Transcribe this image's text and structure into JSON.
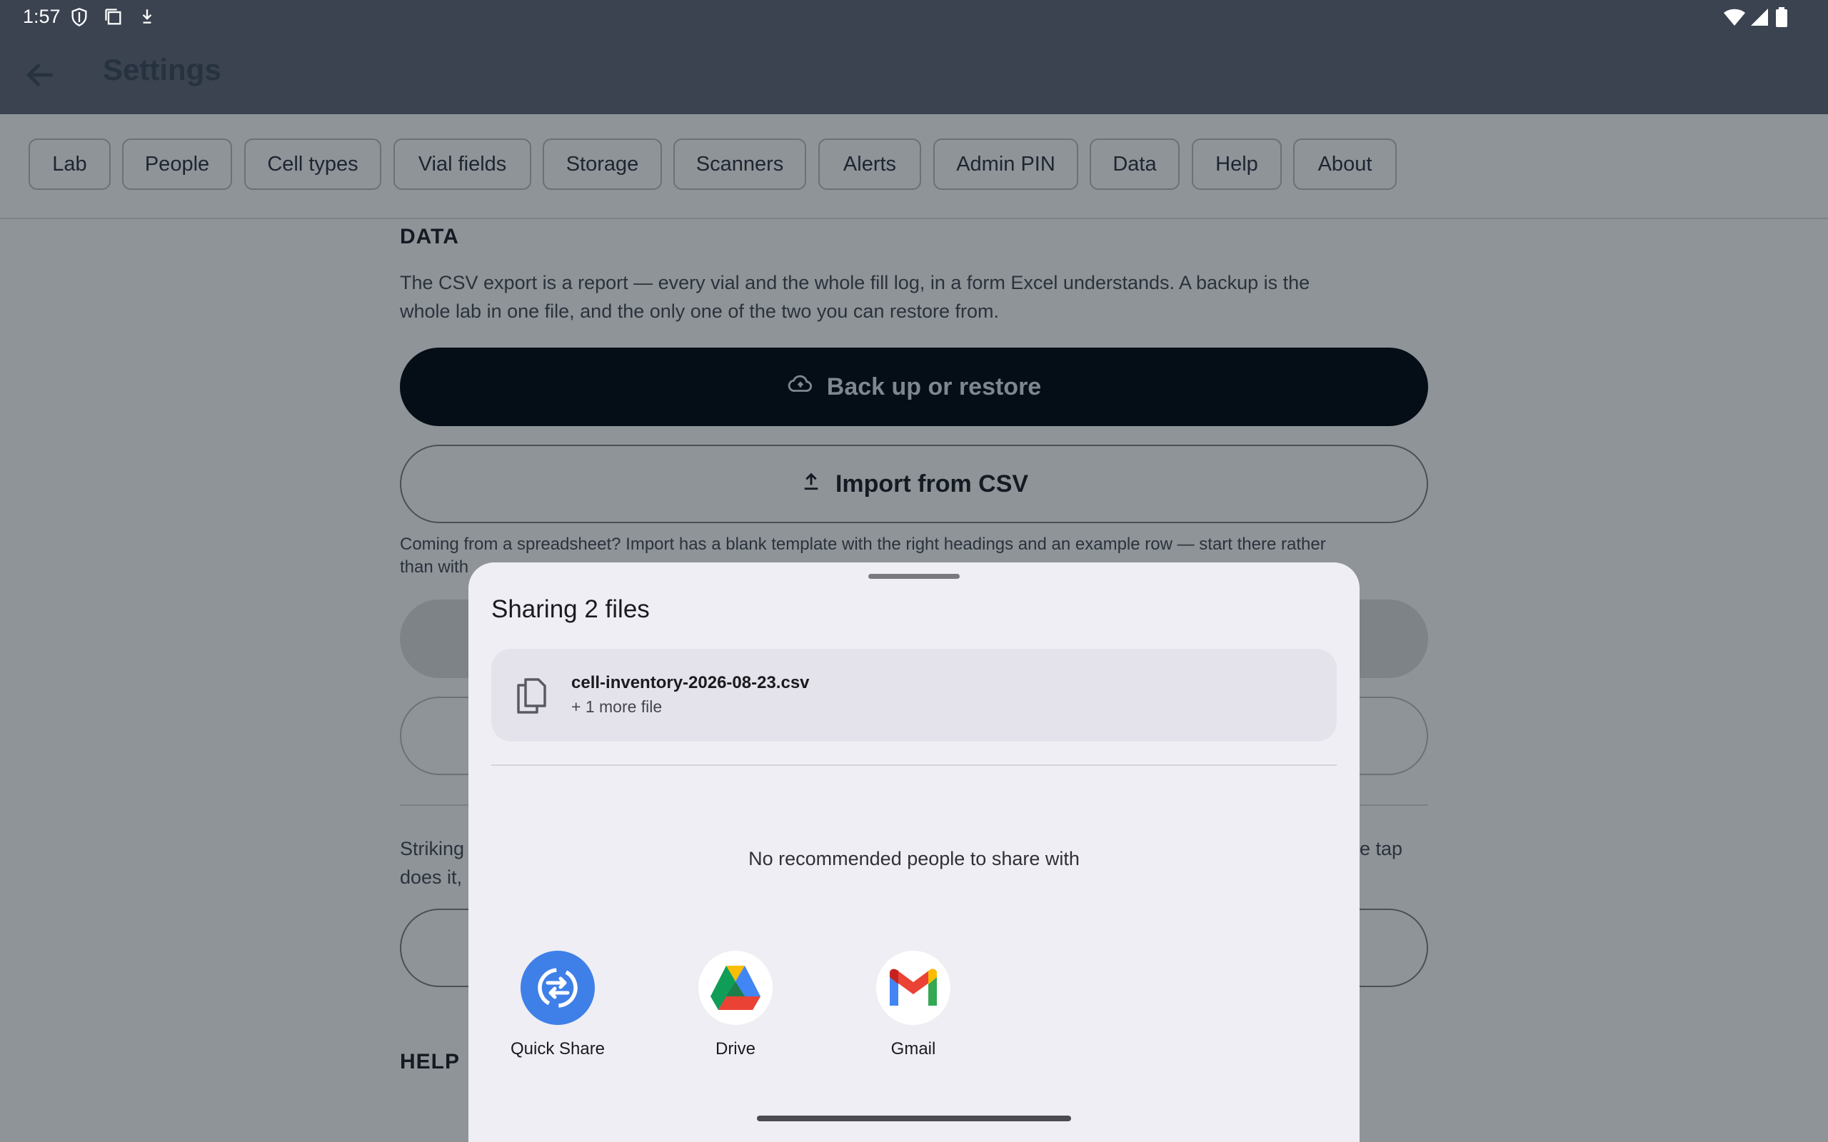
{
  "status_bar": {
    "time": "1:57"
  },
  "app_bar": {
    "title": "Settings"
  },
  "tabs": [
    {
      "label": "Lab"
    },
    {
      "label": "People"
    },
    {
      "label": "Cell types"
    },
    {
      "label": "Vial fields"
    },
    {
      "label": "Storage"
    },
    {
      "label": "Scanners"
    },
    {
      "label": "Alerts"
    },
    {
      "label": "Admin PIN"
    },
    {
      "label": "Data"
    },
    {
      "label": "Help"
    },
    {
      "label": "About"
    }
  ],
  "data_section": {
    "title": "DATA",
    "description_line1": "The CSV export is a report — every vial and the whole fill log, in a form Excel understands. A backup is the",
    "description_line2": "whole lab in one file, and the only one of the two you can restore from.",
    "backup_button": "Back up or restore",
    "import_button": "Import from CSV",
    "import_hint_line1": "Coming from a spreadsheet? Import has a blank template with the right headings and an example row — start there rather",
    "import_hint_line2": "than with",
    "striking_left_1": "Striking",
    "striking_left_2": "does it,",
    "striking_right": "e tap"
  },
  "help_section": {
    "title": "HELP"
  },
  "share_sheet": {
    "title": "Sharing 2 files",
    "file_name": "cell-inventory-2026-08-23.csv",
    "file_more": "+ 1 more file",
    "no_people": "No recommended people to share with",
    "apps": [
      {
        "label": "Quick Share",
        "icon": "quick-share-icon"
      },
      {
        "label": "Drive",
        "icon": "google-drive-icon"
      },
      {
        "label": "Gmail",
        "icon": "gmail-icon"
      }
    ]
  },
  "colors": {
    "app_bar": "#3b4350",
    "backup_button": "#050d17",
    "sheet_background": "#eeeef4",
    "quick_share_blue": "#3f7fe8"
  }
}
